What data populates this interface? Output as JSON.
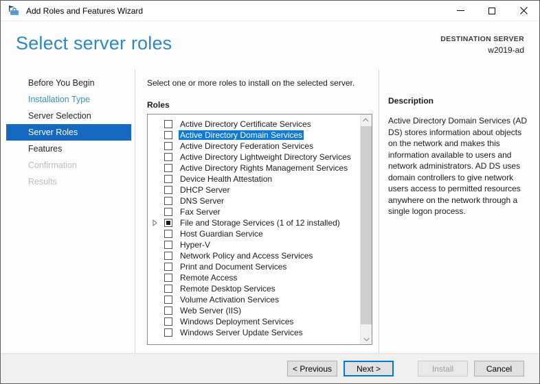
{
  "window": {
    "title": "Add Roles and Features Wizard"
  },
  "header": {
    "title": "Select server roles",
    "destination_label": "DESTINATION SERVER",
    "destination_server": "w2019-ad"
  },
  "sidebar": {
    "items": [
      {
        "label": "Before You Begin",
        "state": "normal"
      },
      {
        "label": "Installation Type",
        "state": "link"
      },
      {
        "label": "Server Selection",
        "state": "normal"
      },
      {
        "label": "Server Roles",
        "state": "selected"
      },
      {
        "label": "Features",
        "state": "normal"
      },
      {
        "label": "Confirmation",
        "state": "disabled"
      },
      {
        "label": "Results",
        "state": "disabled"
      }
    ]
  },
  "main": {
    "instruction": "Select one or more roles to install on the selected server.",
    "roles_label": "Roles",
    "roles": [
      {
        "label": "Active Directory Certificate Services",
        "checkbox": "unchecked",
        "selected": false,
        "expandable": false
      },
      {
        "label": "Active Directory Domain Services",
        "checkbox": "unchecked",
        "selected": true,
        "expandable": false
      },
      {
        "label": "Active Directory Federation Services",
        "checkbox": "unchecked",
        "selected": false,
        "expandable": false
      },
      {
        "label": "Active Directory Lightweight Directory Services",
        "checkbox": "unchecked",
        "selected": false,
        "expandable": false
      },
      {
        "label": "Active Directory Rights Management Services",
        "checkbox": "unchecked",
        "selected": false,
        "expandable": false
      },
      {
        "label": "Device Health Attestation",
        "checkbox": "unchecked",
        "selected": false,
        "expandable": false
      },
      {
        "label": "DHCP Server",
        "checkbox": "unchecked",
        "selected": false,
        "expandable": false
      },
      {
        "label": "DNS Server",
        "checkbox": "unchecked",
        "selected": false,
        "expandable": false
      },
      {
        "label": "Fax Server",
        "checkbox": "unchecked",
        "selected": false,
        "expandable": false
      },
      {
        "label": "File and Storage Services (1 of 12 installed)",
        "checkbox": "indeterminate",
        "selected": false,
        "expandable": true
      },
      {
        "label": "Host Guardian Service",
        "checkbox": "unchecked",
        "selected": false,
        "expandable": false
      },
      {
        "label": "Hyper-V",
        "checkbox": "unchecked",
        "selected": false,
        "expandable": false
      },
      {
        "label": "Network Policy and Access Services",
        "checkbox": "unchecked",
        "selected": false,
        "expandable": false
      },
      {
        "label": "Print and Document Services",
        "checkbox": "unchecked",
        "selected": false,
        "expandable": false
      },
      {
        "label": "Remote Access",
        "checkbox": "unchecked",
        "selected": false,
        "expandable": false
      },
      {
        "label": "Remote Desktop Services",
        "checkbox": "unchecked",
        "selected": false,
        "expandable": false
      },
      {
        "label": "Volume Activation Services",
        "checkbox": "unchecked",
        "selected": false,
        "expandable": false
      },
      {
        "label": "Web Server (IIS)",
        "checkbox": "unchecked",
        "selected": false,
        "expandable": false
      },
      {
        "label": "Windows Deployment Services",
        "checkbox": "unchecked",
        "selected": false,
        "expandable": false
      },
      {
        "label": "Windows Server Update Services",
        "checkbox": "unchecked",
        "selected": false,
        "expandable": false
      }
    ]
  },
  "description": {
    "title": "Description",
    "body": "Active Directory Domain Services (AD DS) stores information about objects on the network and makes this information available to users and network administrators. AD DS uses domain controllers to give network users access to permitted resources anywhere on the network through a single logon process."
  },
  "footer": {
    "previous_label": "< Previous",
    "next_label": "Next >",
    "install_label": "Install",
    "cancel_label": "Cancel"
  },
  "icons": {
    "app": "wizard-flag-toolbox-icon",
    "minimize": "minimize-icon",
    "maximize": "maximize-icon",
    "close": "close-icon",
    "scroll_up": "chevron-up-icon",
    "scroll_down": "chevron-down-icon",
    "expander": "triangle-right-icon"
  },
  "colors": {
    "sidebar_selected_bg": "#1669c1",
    "list_selection_bg": "#0e7ad3",
    "page_title_blue": "#2f86c4",
    "link_blue": "#3e8ec9",
    "disabled_gray": "#bdbdbd",
    "default_button_border": "#0078d7"
  }
}
